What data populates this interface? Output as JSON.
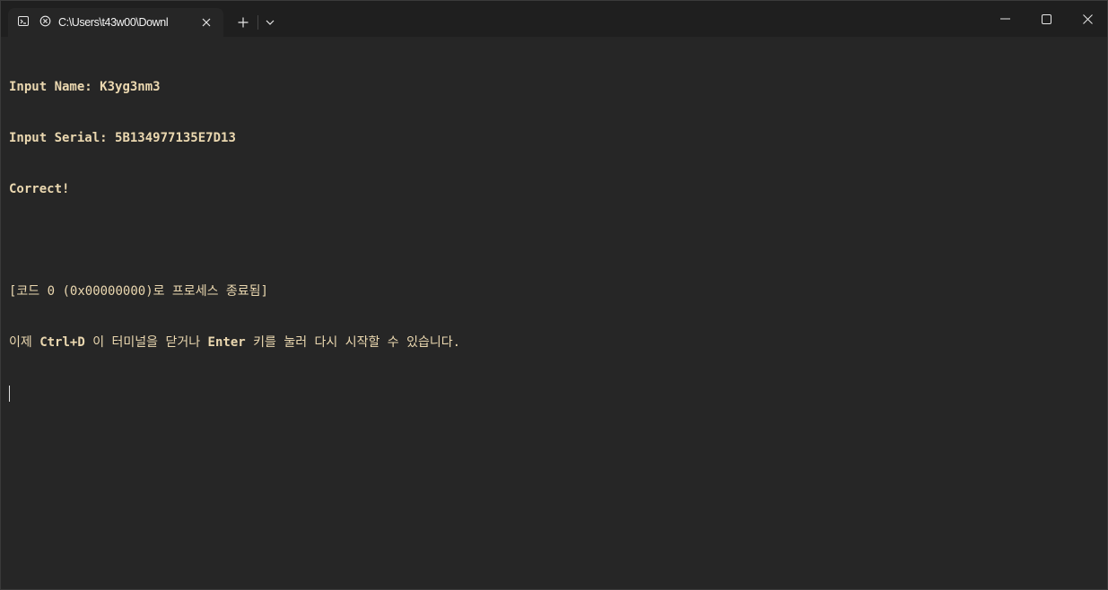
{
  "tab": {
    "title": "C:\\Users\\t43w00\\Downl"
  },
  "terminal": {
    "lines": {
      "name_label": "Input Name: ",
      "name_value": "K3yg3nm3",
      "serial_label": "Input Serial: ",
      "serial_value": "5B134977135E7D13",
      "result": "Correct!",
      "exit_message": "[코드 0 (0x00000000)로 프로세스 종료됨]",
      "hint_prefix": "이제 ",
      "hint_key1": "Ctrl+D",
      "hint_middle": " 이 터미널을 닫거나 ",
      "hint_key2": "Enter",
      "hint_suffix": " 키를 눌러 다시 시작할 수 있습니다."
    }
  },
  "colors": {
    "background": "#262626",
    "titlebar": "#1f1f1f",
    "text": "#ebd8b0"
  }
}
